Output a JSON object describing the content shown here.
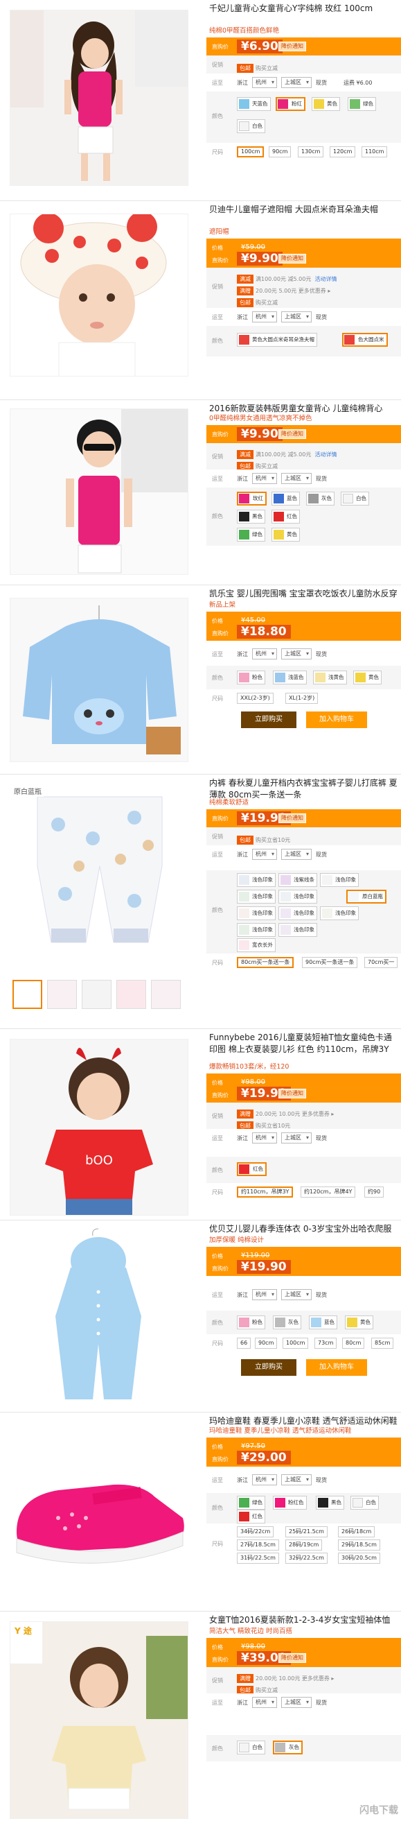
{
  "labels": {
    "price": "直购价",
    "orig": "价格",
    "promo": "促销",
    "ship": "运至",
    "color": "颜色",
    "size": "尺码",
    "buy": "立即购买",
    "cart": "加入购物车"
  },
  "products": [
    {
      "title": "千妃儿童背心女童背心Y字纯棉 玫红 100cm",
      "subtitle": "纯棉0甲醛百搭颜色鲜艳",
      "price": "¥6.90",
      "tag": "降价通知",
      "badge": "包邮",
      "promo_text": "购买立减",
      "city": "浙江",
      "dist": "杭州",
      "area": "上城区",
      "stock": "现货",
      "freight": "运费 ¥6.00",
      "colors": [
        "天蓝色",
        "粉红",
        "黄色",
        "绿色",
        "白色"
      ],
      "sizes": [
        "100cm",
        "90cm",
        "130cm",
        "120cm",
        "110cm"
      ]
    },
    {
      "title": "贝迪牛儿童帽子遮阳帽 大园点米奇耳朵渔夫帽",
      "subtitle": "遮阳帽",
      "old_price": "¥59.00",
      "price": "¥9.90",
      "tag": "降价通知",
      "promo_rows": [
        {
          "badge": "满减",
          "text": "满100.00元 减5.00元",
          "link": "活动详情"
        },
        {
          "badge": "满赠",
          "text": "20.00元  5.00元  更多优惠券 ▸"
        },
        {
          "badge": "包邮",
          "text": "购买立减"
        }
      ],
      "city": "浙江",
      "dist": "杭州",
      "area": "上城区",
      "stock": "现货",
      "colors": [
        "黄色大圆点米奇耳朵渔夫帽",
        "色大圆点米"
      ]
    },
    {
      "title": "2016新款夏装韩版男童女童背心 儿童纯棉背心",
      "subtitle": "0甲醛纯棉男女通用透气凉爽不掉色",
      "price": "¥9.90",
      "tag": "降价通知",
      "promo_rows": [
        {
          "badge": "满减",
          "text": "满100.00元 减5.00元",
          "link": "活动详情"
        },
        {
          "badge": "包邮",
          "text": "购买立减"
        }
      ],
      "city": "浙江",
      "dist": "杭州",
      "area": "上城区",
      "stock": "现货",
      "colors": [
        "玫红",
        "蓝色",
        "灰色",
        "白色",
        "黑色",
        "红色",
        "绿色",
        "黄色"
      ]
    },
    {
      "title": "凯乐宝 婴儿围兜围嘴 宝宝罩衣吃饭衣儿童防水反穿衣",
      "subtitle": "新品上架",
      "old_price": "¥45.00",
      "price": "¥18.80",
      "city": "浙江",
      "dist": "杭州",
      "area": "上城区",
      "stock": "现货",
      "colors": [
        "粉色",
        "浅蓝色",
        "浅黄色",
        "黄色"
      ],
      "sizes": [
        "XXL(2-3岁)",
        "XL(1-2岁)"
      ]
    },
    {
      "title": "内裤 春秋夏儿童开档内衣裤宝宝裤子婴儿打底裤 夏薄款 80cm买一条送一条",
      "subtitle": "纯棉柔软舒适",
      "price": "¥19.90",
      "tag": "降价通知",
      "badge": "包邮",
      "promo_text": "购买立省10元",
      "city": "浙江",
      "dist": "杭州",
      "area": "上城区",
      "stock": "现货",
      "colors": [
        "浅色印象",
        "浅紫线条",
        "浅色印象",
        "浅色印象",
        "原白蓝瓶",
        "浅色印象",
        "浅色印象",
        "浅色印象",
        "浅色印象",
        "浅色印象",
        "浅色印象",
        "宽衣长外"
      ],
      "sizes": [
        "80cm买一条送一条",
        "90cm买一条送一条",
        "70cm买一"
      ],
      "image_badge": "原白蓝瓶"
    },
    {
      "title": "Funnybebe 2016儿童夏装短袖T恤女童纯色卡通印图 棉上衣夏装婴儿衫 红色 约110cm，吊牌3Y",
      "subtitle": "爆款畅销103套/米，经120",
      "old_price": "¥98.00",
      "price": "¥19.90",
      "tag": "降价通知",
      "promo_rows": [
        {
          "badge": "满赠",
          "text": "20.00元  10.00元  更多优惠券 ▸"
        },
        {
          "badge": "包邮",
          "text": "购买立省10元"
        }
      ],
      "city": "浙江",
      "dist": "杭州",
      "area": "上城区",
      "stock": "现货",
      "colors": [
        "红色"
      ],
      "sizes": [
        "约110cm，吊牌3Y",
        "约120cm，吊牌4Y",
        "约90"
      ]
    },
    {
      "title": "优贝艾儿婴儿春季连体衣 0-3岁宝宝外出哈衣爬服儿衣",
      "subtitle": "加厚保暖 纯棉设计",
      "old_price": "¥119.00",
      "price": "¥19.90",
      "city": "浙江",
      "dist": "杭州",
      "area": "上城区",
      "stock": "现货",
      "colors": [
        "粉色",
        "灰色",
        "蓝色",
        "黄色"
      ],
      "sizes": [
        "66",
        "90cm",
        "100cm",
        "73cm",
        "80cm",
        "85cm"
      ]
    },
    {
      "title": "玛哈迪童鞋 春夏季儿童小凉鞋 透气舒适运动休闲鞋",
      "subtitle": "玛哈迪童鞋 夏季儿童小凉鞋 透气舒适运动休闲鞋",
      "old_price": "¥97.50",
      "price": "¥29.00",
      "city": "浙江",
      "dist": "杭州",
      "area": "上城区",
      "stock": "现货",
      "colors": [
        "绿色",
        "粉红色",
        "黑色",
        "白色",
        "红色"
      ],
      "sizes": [
        "34码/22cm",
        "25码/21.5cm",
        "26码/18cm",
        "27码/18.5cm",
        "28码/19cm",
        "29码/18.5cm",
        "31码/22.5cm",
        "32码/22.5cm",
        "30码/20.5cm"
      ]
    },
    {
      "title": "女童T恤2016夏装新款1-2-3-4岁女宝宝短袖体恤衫儿童",
      "subtitle": "简洁大气 精致花边 时尚百搭",
      "old_price": "¥98.00",
      "price": "¥39.00",
      "tag": "降价通知",
      "promo_rows": [
        {
          "badge": "满赠",
          "text": "20.00元  10.00元  更多优惠券 ▸"
        },
        {
          "badge": "包邮",
          "text": "购买立减"
        }
      ],
      "city": "浙江",
      "dist": "杭州",
      "area": "上城区",
      "stock": "现货",
      "colors": [
        "白色",
        "灰色"
      ],
      "logo_text": "Y 途"
    }
  ],
  "watermark": "闪电下载",
  "colors": {
    "orange": "#ff9500",
    "price_box": "#e4520e",
    "badge": "#f05a00",
    "select": "#f08300"
  }
}
